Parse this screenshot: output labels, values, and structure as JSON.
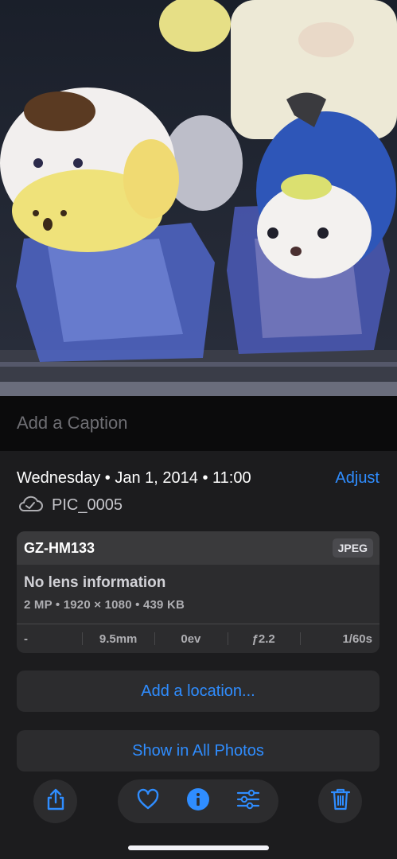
{
  "photo": {
    "subject": "figurines photo"
  },
  "caption": {
    "placeholder": "Add a Caption"
  },
  "info": {
    "date_line": "Wednesday • Jan 1, 2014 • 11:00",
    "adjust_label": "Adjust",
    "file_name": "PIC_0005"
  },
  "metadata": {
    "camera": "GZ-HM133",
    "format": "JPEG",
    "lens": "No lens information",
    "specs": "2 MP • 1920 × 1080 • 439 KB",
    "exif": [
      "-",
      "9.5mm",
      "0ev",
      "ƒ2.2",
      "1/60s"
    ]
  },
  "actions": {
    "add_location": "Add a location...",
    "show_all": "Show in All Photos"
  },
  "toolbar": {
    "icons": [
      "share-icon",
      "heart-icon",
      "info-icon",
      "adjust-icon",
      "trash-icon"
    ]
  },
  "colors": {
    "accent": "#2f8dff",
    "background": "#1c1c1e",
    "card": "#2c2c2e"
  }
}
